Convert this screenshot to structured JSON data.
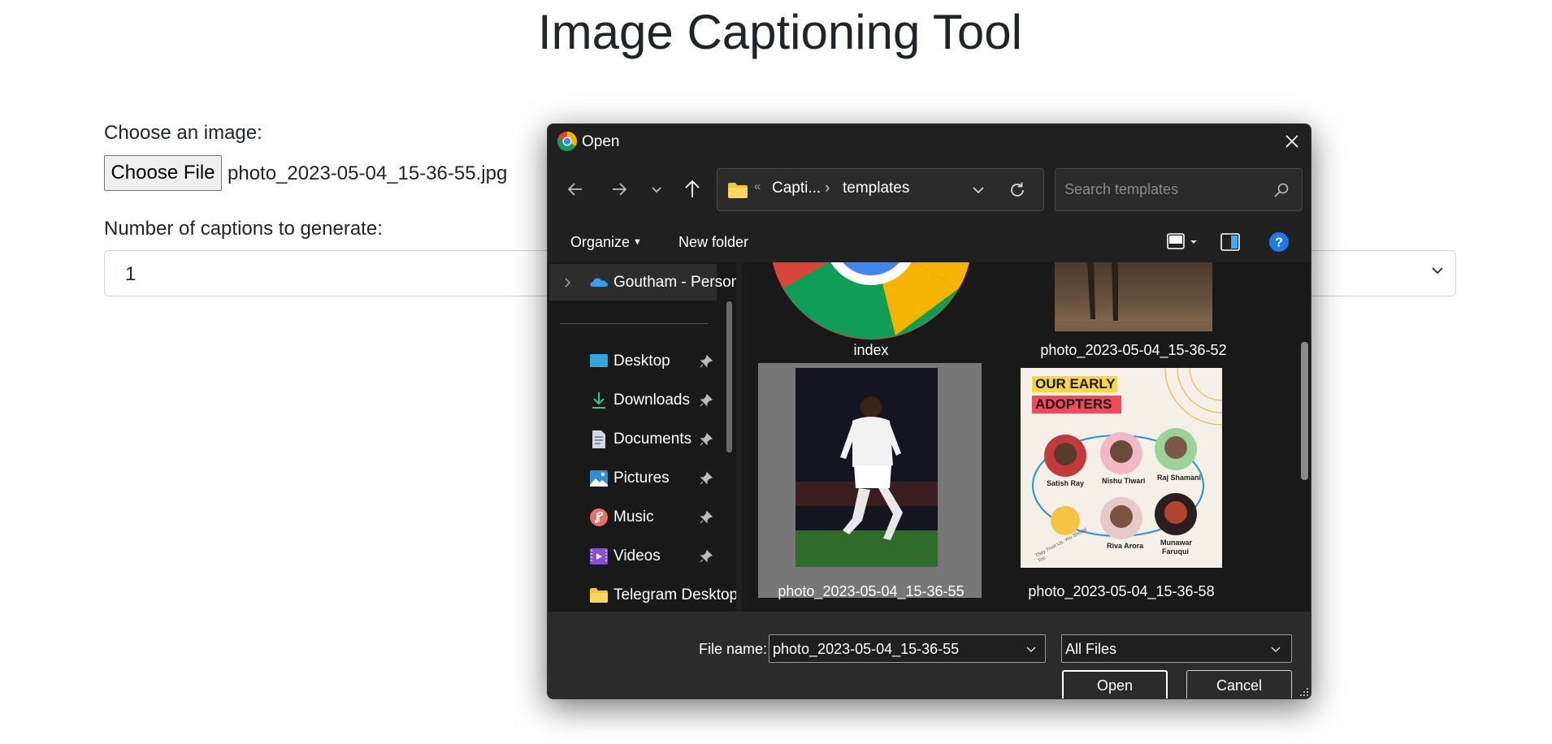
{
  "page": {
    "title": "Image Captioning Tool",
    "choose_label": "Choose an image:",
    "file_button": "Choose File",
    "file_name": "photo_2023-05-04_15-36-55.jpg",
    "count_label": "Number of captions to generate:",
    "count_value": "1"
  },
  "dialog": {
    "title": "Open",
    "address": {
      "overflow": "«",
      "segment1": "Capti...",
      "separator": "›",
      "segment2": "templates"
    },
    "search_placeholder": "Search templates",
    "commands": {
      "organize": "Organize",
      "new_folder": "New folder"
    },
    "nav_items": [
      {
        "label": "Goutham - Personal",
        "icon": "onedrive-icon"
      },
      {
        "label": "Desktop",
        "icon": "desktop-icon",
        "pinned": true
      },
      {
        "label": "Downloads",
        "icon": "downloads-icon",
        "pinned": true
      },
      {
        "label": "Documents",
        "icon": "documents-icon",
        "pinned": true
      },
      {
        "label": "Pictures",
        "icon": "pictures-icon",
        "pinned": true
      },
      {
        "label": "Music",
        "icon": "music-icon",
        "pinned": true
      },
      {
        "label": "Videos",
        "icon": "videos-icon",
        "pinned": true
      },
      {
        "label": "Telegram Desktop",
        "icon": "folder-icon"
      }
    ],
    "files": [
      {
        "name": "index",
        "thumbnail": "chrome-logo"
      },
      {
        "name": "photo_2023-05-04_15-36-52",
        "thumbnail": "photo"
      },
      {
        "name": "photo_2023-05-04_15-36-55",
        "thumbnail": "photo",
        "selected": true
      },
      {
        "name": "photo_2023-05-04_15-36-58",
        "thumbnail": "poster"
      }
    ],
    "poster": {
      "heading1": "OUR EARLY",
      "heading2": "ADOPTERS",
      "names": [
        "Satish Ray",
        "Nishu Tiwari",
        "Raj Shamani",
        "Riva Arora",
        "Munawar",
        "Faruqui"
      ],
      "ring_text": "They Trust Us, You Should Too"
    },
    "footer": {
      "file_name_label": "File name:",
      "file_name_value": "photo_2023-05-04_15-36-55",
      "file_type": "All Files",
      "open": "Open",
      "cancel": "Cancel"
    },
    "colors": {
      "background": "#202020",
      "pane": "#191919",
      "selection": "#777777",
      "footer": "#2b2b2b"
    }
  }
}
